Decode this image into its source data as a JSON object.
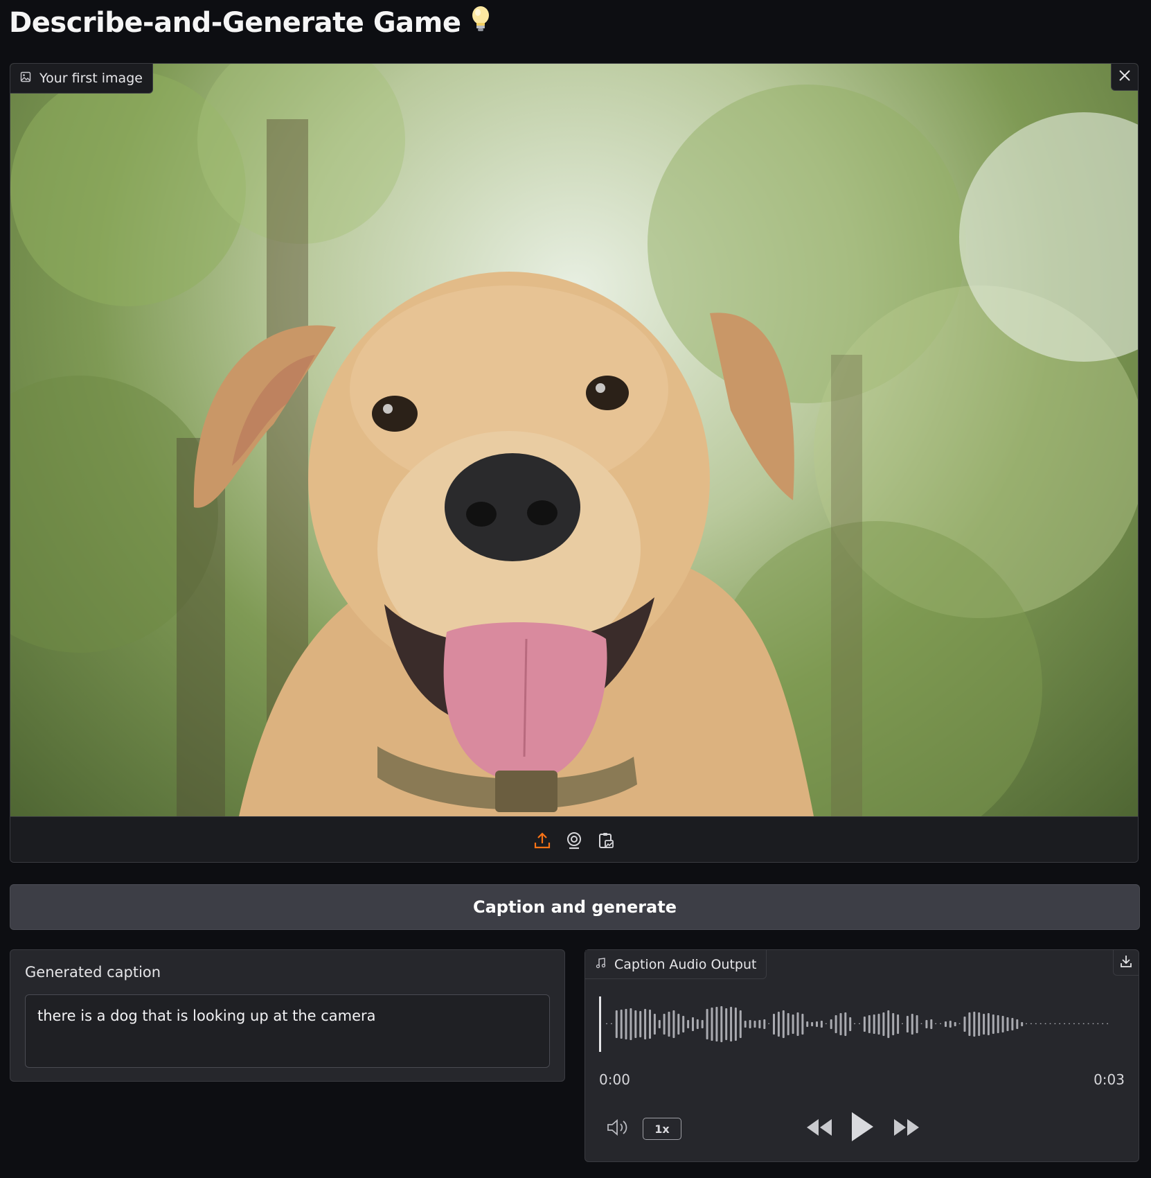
{
  "title": "Describe-and-Generate Game",
  "title_emoji": "💡",
  "image_block": {
    "label": "Your first image",
    "icon": "image-icon",
    "close_icon": "close-icon",
    "sources": [
      "upload-icon",
      "webcam-icon",
      "clipboard-icon"
    ]
  },
  "caption_button": "Caption and generate",
  "caption_panel": {
    "label": "Generated caption",
    "value": "there is a dog that is looking up at the camera"
  },
  "audio_panel": {
    "label": "Caption Audio Output",
    "icon": "music-note-icon",
    "download_icon": "download-icon",
    "time_current": "0:00",
    "time_total": "0:03",
    "playback_rate": "1x",
    "progress": 0
  },
  "colors": {
    "background": "#0d0e12",
    "panel": "#26272c",
    "button": "#3d3e46",
    "accent_upload": "#f97316",
    "waveform": "#a9aab0"
  }
}
